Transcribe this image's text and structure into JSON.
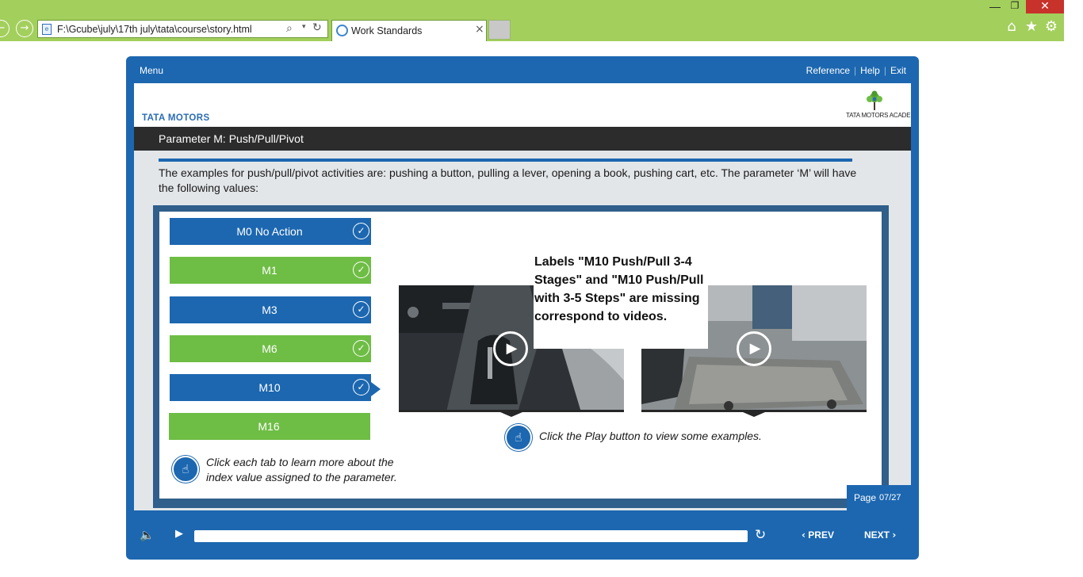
{
  "browser": {
    "back_icon": "←",
    "forward_icon": "→",
    "address": "F:\\Gcube\\july\\17th july\\tata\\course\\story.html",
    "search_icon": "⌕",
    "dropdown_icon": "▾",
    "refresh_icon": "↻",
    "tab_title": "Work Standards",
    "tab_close": "×",
    "minimize": "—",
    "maximize": "❐",
    "close": "✕",
    "home_icon": "⌂",
    "favorites_icon": "★",
    "settings_icon": "⚙",
    "accent_color": "#a3cf5c"
  },
  "player": {
    "menu": "Menu",
    "links": [
      "Reference",
      "Help",
      "Exit"
    ],
    "brand_color": "#1c67b0"
  },
  "slide": {
    "brand": "TATA MOTORS",
    "academy": "TATA MOTORS ACADEMY",
    "title": "Parameter M: Push/Pull/Pivot",
    "intro": "The examples for push/pull/pivot activities are: pushing a button, pulling a lever, opening a book, pushing cart, etc. The parameter ‘M’ will have the following values:",
    "tabs": [
      {
        "label": "M0 No Action",
        "color": "blue",
        "visited": true
      },
      {
        "label": "M1",
        "color": "green",
        "visited": true
      },
      {
        "label": "M3",
        "color": "blue",
        "visited": true
      },
      {
        "label": "M6",
        "color": "green",
        "visited": true
      },
      {
        "label": "M10",
        "color": "blue",
        "visited": true,
        "selected": true
      },
      {
        "label": "M16",
        "color": "green",
        "visited": false
      }
    ],
    "check_icon": "✓",
    "tab_hint": "Click each tab to learn more about the index value assigned to the parameter.",
    "video_hint": "Click the Play button to view some examples.",
    "hand_icon": "☝",
    "play_icon": "▶",
    "annotation": "Labels \"M10 Push/Pull 3-4 Stages\" and \"M10 Push/Pull with 3-5 Steps\" are missing correspond to videos.",
    "page_label": "Page",
    "page_number": "07/27"
  },
  "controls": {
    "volume_icon": "🔈",
    "play_icon": "▶",
    "progress": 0.0,
    "replay_icon": "↻",
    "prev": "PREV",
    "next": "NEXT",
    "prev_icon": "‹",
    "next_icon": "›"
  }
}
